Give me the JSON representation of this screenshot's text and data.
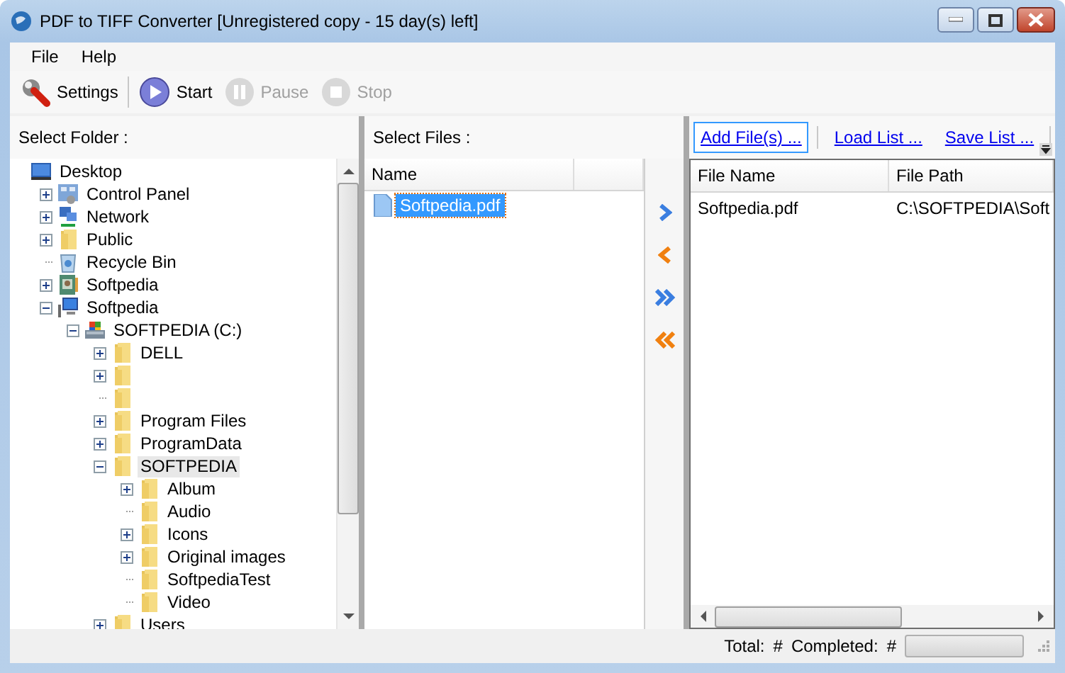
{
  "window": {
    "title": "PDF to TIFF Converter [Unregistered copy - 15 day(s) left]"
  },
  "menu": [
    "File",
    "Help"
  ],
  "toolbar": [
    {
      "label": "Settings",
      "kind": "settings",
      "disabled": false
    },
    {
      "label": "Start",
      "kind": "start",
      "disabled": false
    },
    {
      "label": "Pause",
      "kind": "pause",
      "disabled": true
    },
    {
      "label": "Stop",
      "kind": "stop",
      "disabled": true
    }
  ],
  "folder_panel": {
    "title": "Select Folder :"
  },
  "folder_tree": {
    "items": [
      {
        "label": "Desktop",
        "kind": "desktop",
        "selected": false,
        "children": [
          {
            "label": "Control Panel",
            "kind": "control-panel",
            "expanded": false,
            "selected": false
          },
          {
            "label": "Network",
            "kind": "network",
            "expanded": false,
            "selected": false
          },
          {
            "label": "Public",
            "kind": "folder",
            "expanded": false,
            "selected": false
          },
          {
            "label": "Recycle Bin",
            "kind": "recycle-bin",
            "selected": false
          },
          {
            "label": "Softpedia",
            "kind": "user",
            "expanded": false,
            "selected": false
          },
          {
            "label": "Softpedia",
            "kind": "computer",
            "expanded": true,
            "selected": false,
            "children": [
              {
                "label": "SOFTPEDIA (C:)",
                "kind": "drive",
                "expanded": true,
                "selected": false,
                "children": [
                  {
                    "label": "DELL",
                    "kind": "folder",
                    "expanded": false,
                    "selected": false
                  },
                  {
                    "kind": "folder",
                    "expanded": false,
                    "selected": false
                  },
                  {
                    "kind": "folder",
                    "selected": false
                  },
                  {
                    "label": "Program Files",
                    "kind": "folder",
                    "expanded": false,
                    "selected": false
                  },
                  {
                    "label": "ProgramData",
                    "kind": "folder",
                    "expanded": false,
                    "selected": false
                  },
                  {
                    "label": "SOFTPEDIA",
                    "kind": "folder",
                    "expanded": true,
                    "selected": true,
                    "children": [
                      {
                        "label": "Album",
                        "kind": "folder",
                        "expanded": false,
                        "selected": false
                      },
                      {
                        "label": "Audio",
                        "kind": "folder",
                        "selected": false
                      },
                      {
                        "label": "Icons",
                        "kind": "folder",
                        "expanded": false,
                        "selected": false
                      },
                      {
                        "label": "Original images",
                        "kind": "folder",
                        "expanded": false,
                        "selected": false
                      },
                      {
                        "label": "SoftpediaTest",
                        "kind": "folder",
                        "selected": false
                      },
                      {
                        "label": "Video",
                        "kind": "folder",
                        "selected": false
                      }
                    ]
                  },
                  {
                    "label": "Users",
                    "kind": "folder",
                    "expanded": false,
                    "selected": false
                  }
                ]
              }
            ]
          }
        ]
      }
    ]
  },
  "files_panel": {
    "title": "Select Files :",
    "columns": [
      "Name"
    ],
    "files": [
      {
        "name": "Softpedia.pdf",
        "selected": true
      }
    ]
  },
  "list_panel": {
    "links": [
      {
        "label": "Add File(s) ...",
        "focused": true
      },
      {
        "label": "Load List ...",
        "focused": false
      },
      {
        "label": "Save List ...",
        "focused": false
      }
    ],
    "columns": [
      "File Name",
      "File Path"
    ],
    "rows": [
      [
        "Softpedia.pdf",
        "C:\\SOFTPEDIA\\Soft"
      ]
    ]
  },
  "status_bar": {
    "total_label": "Total:",
    "total": "#",
    "completed_label": "Completed:",
    "completed": "#",
    "progress": {
      "level": 0
    }
  }
}
